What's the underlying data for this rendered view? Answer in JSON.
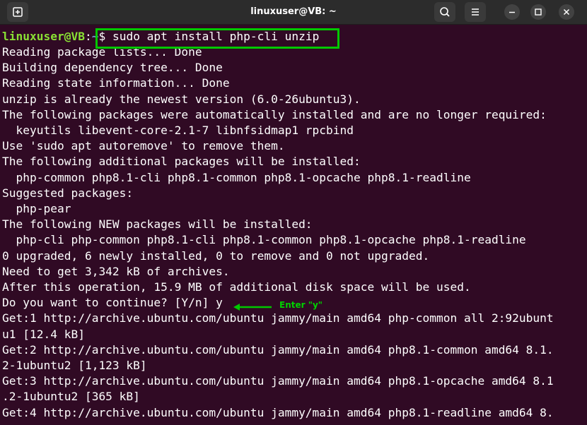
{
  "window": {
    "title": "linuxuser@VB: ~"
  },
  "prompt": {
    "user_host": "linuxuser@VB",
    "separator": ":",
    "path": "~",
    "symbol": "$",
    "command": "sudo apt install php-cli unzip"
  },
  "output_lines": [
    "Reading package lists... Done",
    "Building dependency tree... Done",
    "Reading state information... Done",
    "unzip is already the newest version (6.0-26ubuntu3).",
    "The following packages were automatically installed and are no longer required:",
    "  keyutils libevent-core-2.1-7 libnfsidmap1 rpcbind",
    "Use 'sudo apt autoremove' to remove them.",
    "The following additional packages will be installed:",
    "  php-common php8.1-cli php8.1-common php8.1-opcache php8.1-readline",
    "Suggested packages:",
    "  php-pear",
    "The following NEW packages will be installed:",
    "  php-cli php-common php8.1-cli php8.1-common php8.1-opcache php8.1-readline",
    "0 upgraded, 6 newly installed, 0 to remove and 0 not upgraded.",
    "Need to get 3,342 kB of archives.",
    "After this operation, 15.9 MB of additional disk space will be used.",
    "Do you want to continue? [Y/n] y",
    "Get:1 http://archive.ubuntu.com/ubuntu jammy/main amd64 php-common all 2:92ubunt",
    "u1 [12.4 kB]",
    "Get:2 http://archive.ubuntu.com/ubuntu jammy/main amd64 php8.1-common amd64 8.1.",
    "2-1ubuntu2 [1,123 kB]",
    "Get:3 http://archive.ubuntu.com/ubuntu jammy/main amd64 php8.1-opcache amd64 8.1",
    ".2-1ubuntu2 [365 kB]",
    "Get:4 http://archive.ubuntu.com/ubuntu jammy/main amd64 php8.1-readline amd64 8."
  ],
  "annotation": {
    "text": "Enter \"y\"",
    "color": "#00d000"
  },
  "colors": {
    "terminal_bg": "#300a24",
    "prompt_user": "#8ae234",
    "prompt_path": "#729fcf",
    "highlight_box": "#00c800",
    "titlebar_bg": "#2c2c2c"
  },
  "icons": {
    "new_tab": "new-tab-icon",
    "search": "search-icon",
    "menu": "hamburger-menu-icon",
    "minimize": "minimize-icon",
    "maximize": "maximize-icon",
    "close": "close-icon"
  }
}
